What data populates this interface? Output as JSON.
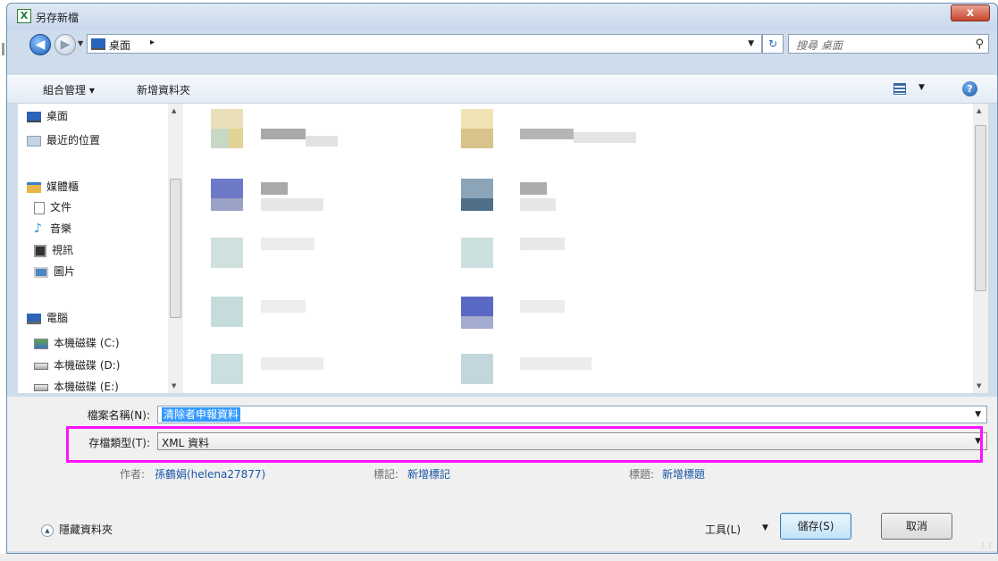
{
  "window": {
    "title": "另存新檔",
    "app_icon": "X",
    "close_label": "x"
  },
  "navigation": {
    "back_icon": "arrow-left",
    "forward_icon": "arrow-right",
    "address": {
      "location": "桌面",
      "separator": "▸"
    },
    "refresh_icon": "↻",
    "search": {
      "placeholder": "搜尋 桌面"
    }
  },
  "toolbar": {
    "organize_label": "組合管理 ▾",
    "new_folder_label": "新增資料夾",
    "help_label": "?"
  },
  "sidebar": {
    "items": [
      {
        "label": "桌面",
        "icon": "desktop-icon",
        "color": "#2b64b8"
      },
      {
        "label": "最近的位置",
        "icon": "recent-places-icon",
        "color": "#8ba2bd"
      },
      {
        "label": "媒體櫃",
        "icon": "libraries-icon",
        "color": "#e6b547"
      },
      {
        "label": "文件",
        "icon": "documents-icon",
        "color": "#ffffff"
      },
      {
        "label": "音樂",
        "icon": "music-icon",
        "color": "#2a8fd6"
      },
      {
        "label": "視訊",
        "icon": "video-icon",
        "color": "#333333"
      },
      {
        "label": "圖片",
        "icon": "pictures-icon",
        "color": "#4d86c4"
      },
      {
        "label": "電腦",
        "icon": "computer-icon",
        "color": "#2b64b8"
      },
      {
        "label": "本機磁碟 (C:)",
        "icon": "drive-c-icon",
        "color": "#5ea84e"
      },
      {
        "label": "本機磁碟 (D:)",
        "icon": "drive-d-icon",
        "color": "#a0a0a0"
      },
      {
        "label": "本機磁碟 (E:)",
        "icon": "drive-e-icon",
        "color": "#a0a0a0"
      }
    ]
  },
  "form": {
    "filename_label": "檔案名稱(N):",
    "filename_value": "清除者申報資料",
    "filetype_label": "存檔類型(T):",
    "filetype_value": "XML 資料",
    "author_label": "作者:",
    "author_value": "孫鶴娟(helena27877)",
    "tags_label": "標記:",
    "tags_value": "新增標記",
    "title_label": "標題:",
    "title_value": "新增標題"
  },
  "footer": {
    "hide_folders_label": "隱藏資料夾",
    "tools_label": "工具(L)",
    "save_label": "儲存(S)",
    "cancel_label": "取消"
  },
  "colors": {
    "highlight": "#ff11ff",
    "selection": "#3399ff",
    "link": "#1a56a5"
  }
}
